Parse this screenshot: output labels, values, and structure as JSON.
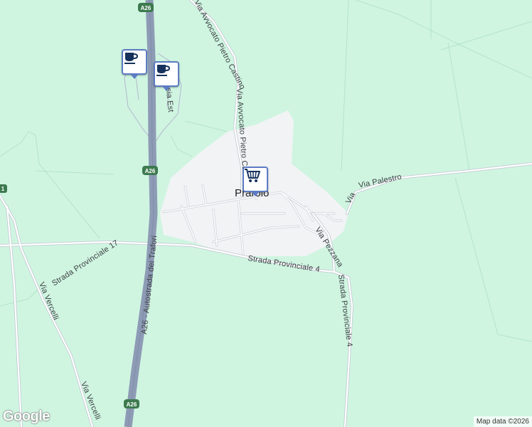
{
  "map": {
    "town_label": "Prarolo",
    "roads": {
      "via_avvocato_pietro_castino": "Via Avvocato Pietro Castino",
      "via_avvocato_pietro_ca": "Via Avvocato Pietro Ca",
      "via_palestro": "Via Palestro",
      "via_pezzana": "Via Pezzana",
      "strada_provinciale_4_a": "Strada Provinciale 4",
      "strada_provinciale_4_b": "Strada Provinciale 4",
      "strada_provinciale_17": "Strada Provinciale 17",
      "via_vercelli_a": "Via Vercelli",
      "via_vercelli_b": "Via Vercelli",
      "autostrada": "A26 - Autostrada dei Trafori",
      "sesia_est": "Sesia Est"
    },
    "shields": {
      "top": "A26",
      "mid": "A26",
      "bottom": "A26",
      "left_edge": "1"
    },
    "pois": [
      {
        "name": "cafe",
        "icon": "coffee-cup-icon"
      },
      {
        "name": "cafe",
        "icon": "coffee-cup-icon"
      },
      {
        "name": "shopping",
        "icon": "shopping-cart-icon"
      }
    ],
    "logo": "Google",
    "attribution": "Map data ©2026"
  },
  "colors": {
    "land": "#cff5e1",
    "urban": "#f1f3f4",
    "highway": "#8e9bb5",
    "road": "#ffffff",
    "road_outline": "#c5cbd3",
    "poi_border": "#5c7cc4",
    "shield": "#3d7a4f"
  }
}
